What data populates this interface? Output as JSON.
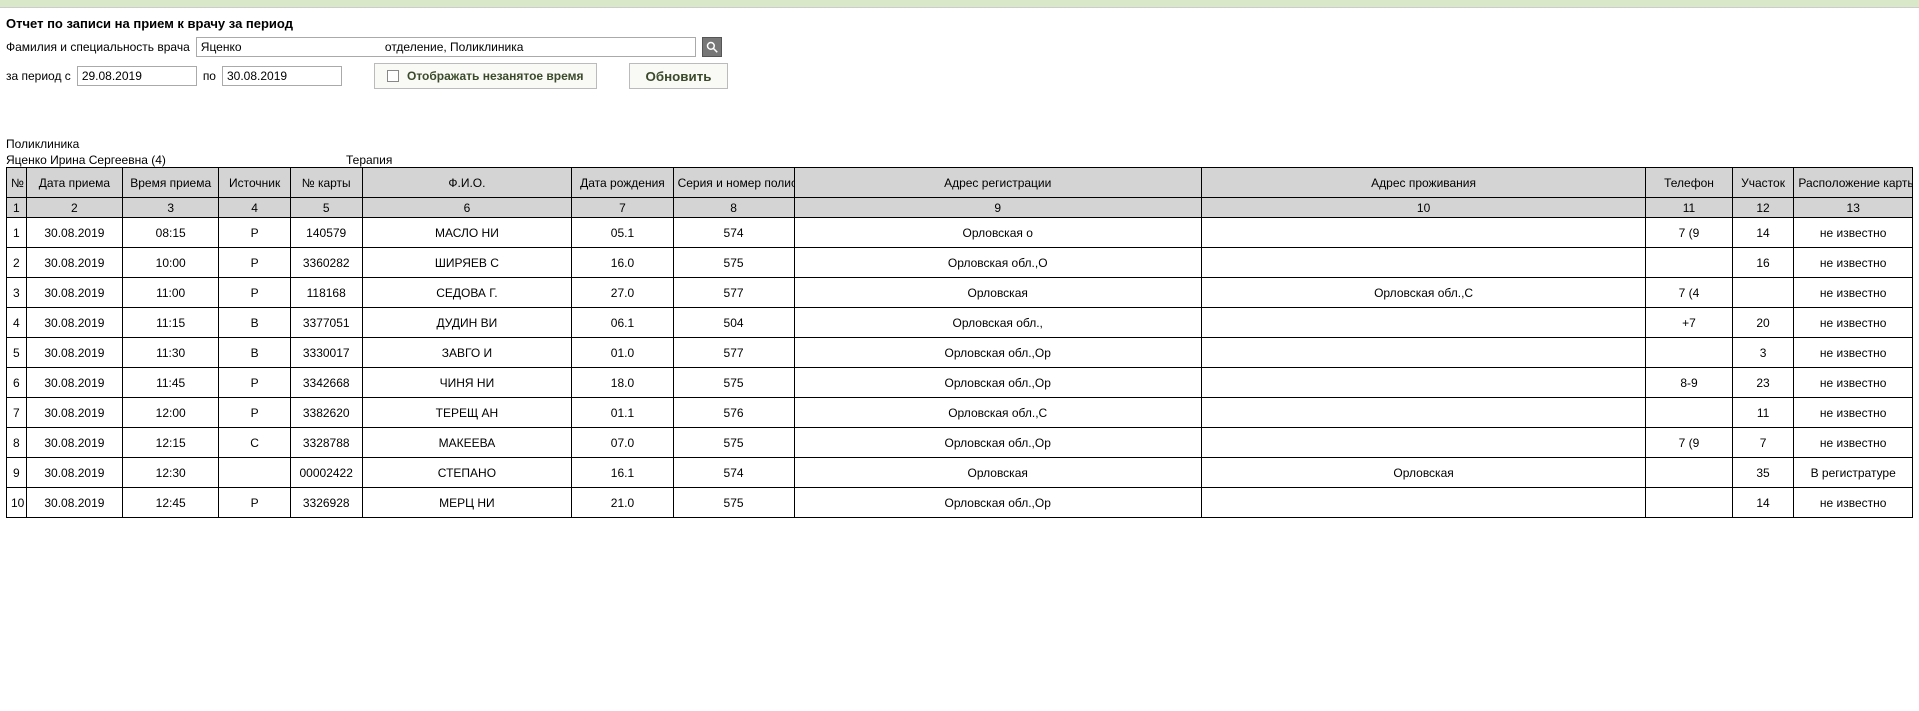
{
  "title": "Отчет по записи на прием к врачу за период",
  "labels": {
    "doctor": "Фамилия и специальность врача",
    "period_from": "за период с",
    "period_to": "по",
    "show_free": "Отображать незанятое время",
    "refresh": "Обновить"
  },
  "filters": {
    "doctor_value": "Яценко                                           отделение, Поликлиника",
    "date_from": "29.08.2019",
    "date_to": "30.08.2019"
  },
  "meta": {
    "clinic": "Поликлиника",
    "doctor_line": "Яценко Ирина Сергеевна (4)",
    "specialty": "Терапия"
  },
  "columns": {
    "n": "№",
    "date": "Дата приема",
    "time": "Время приема",
    "source": "Источник",
    "card": "№ карты",
    "fio": "Ф.И.О.",
    "dob": "Дата рождения",
    "policy": "Серия и номер полиса",
    "reg_addr": "Адрес регистрации",
    "live_addr": "Адрес проживания",
    "phone": "Телефон",
    "district": "Участок",
    "card_loc": "Расположение карты"
  },
  "col_nums": [
    "1",
    "2",
    "3",
    "4",
    "5",
    "6",
    "7",
    "8",
    "9",
    "10",
    "11",
    "12",
    "13"
  ],
  "rows": [
    {
      "n": "1",
      "date": "30.08.2019",
      "time": "08:15",
      "src": "Р",
      "card": "140579",
      "fio": "МАСЛО\nНИ",
      "dob": "05.1",
      "policy": "574",
      "reg": "Орловская о",
      "live": "",
      "phone": "7 (9",
      "district": "14",
      "loc": "не известно"
    },
    {
      "n": "2",
      "date": "30.08.2019",
      "time": "10:00",
      "src": "Р",
      "card": "3360282",
      "fio": "ШИРЯЕВ С",
      "dob": "16.0",
      "policy": "575",
      "reg": "Орловская обл.,О",
      "live": "",
      "phone": "",
      "district": "16",
      "loc": "не известно"
    },
    {
      "n": "3",
      "date": "30.08.2019",
      "time": "11:00",
      "src": "Р",
      "card": "118168",
      "fio": "СЕДОВА Г.",
      "dob": "27.0",
      "policy": "577",
      "reg": "Орловская",
      "live": "Орловская обл.,С",
      "phone": "7 (4",
      "district": "",
      "loc": "не известно"
    },
    {
      "n": "4",
      "date": "30.08.2019",
      "time": "11:15",
      "src": "В",
      "card": "3377051",
      "fio": "ДУДИН ВИ",
      "dob": "06.1",
      "policy": "504",
      "reg": "Орловская обл.,",
      "live": "",
      "phone": "+7",
      "district": "20",
      "loc": "не известно"
    },
    {
      "n": "5",
      "date": "30.08.2019",
      "time": "11:30",
      "src": "В",
      "card": "3330017",
      "fio": "ЗАВГО\nИ",
      "dob": "01.0",
      "policy": "577",
      "reg": "Орловская обл.,Ор",
      "live": "",
      "phone": "",
      "district": "3",
      "loc": "не известно"
    },
    {
      "n": "6",
      "date": "30.08.2019",
      "time": "11:45",
      "src": "Р",
      "card": "3342668",
      "fio": "ЧИНЯ\nНИ",
      "dob": "18.0",
      "policy": "575",
      "reg": "Орловская обл.,Ор",
      "live": "",
      "phone": "8-9",
      "district": "23",
      "loc": "не известно"
    },
    {
      "n": "7",
      "date": "30.08.2019",
      "time": "12:00",
      "src": "Р",
      "card": "3382620",
      "fio": "ТЕРЕЩ\nАН",
      "dob": "01.1",
      "policy": "576",
      "reg": "Орловская обл.,С",
      "live": "",
      "phone": "",
      "district": "11",
      "loc": "не известно"
    },
    {
      "n": "8",
      "date": "30.08.2019",
      "time": "12:15",
      "src": "С",
      "card": "3328788",
      "fio": "МАКЕЕВА",
      "dob": "07.0",
      "policy": "575",
      "reg": "Орловская обл.,Ор",
      "live": "",
      "phone": "7 (9",
      "district": "7",
      "loc": "не известно"
    },
    {
      "n": "9",
      "date": "30.08.2019",
      "time": "12:30",
      "src": "",
      "card": "00002422",
      "fio": "СТЕПАНО",
      "dob": "16.1",
      "policy": "574",
      "reg": "Орловская",
      "live": "Орловская",
      "phone": "",
      "district": "35",
      "loc": "В регистратуре"
    },
    {
      "n": "10",
      "date": "30.08.2019",
      "time": "12:45",
      "src": "Р",
      "card": "3326928",
      "fio": "МЕРЦ\nНИ",
      "dob": "21.0",
      "policy": "575",
      "reg": "Орловская обл.,Ор",
      "live": "",
      "phone": "",
      "district": "14",
      "loc": "не известно"
    }
  ]
}
